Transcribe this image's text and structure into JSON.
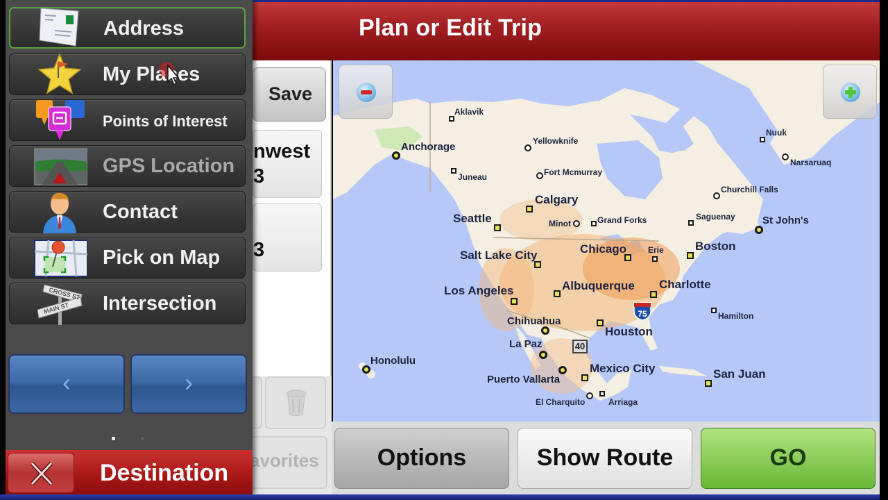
{
  "header": {
    "title": "Plan or Edit Trip"
  },
  "trip_list": {
    "save_label": "Save",
    "stops": [
      {
        "line1": "nwest",
        "line2": "3"
      },
      {
        "line1": "",
        "line2": "3"
      }
    ],
    "favorites_label": "avorites"
  },
  "map": {
    "zoom_out_icon": "minus-icon",
    "zoom_in_icon": "plus-icon",
    "labels": [
      {
        "name": "Aklavik",
        "size": "small"
      },
      {
        "name": "Yellowknife",
        "size": "small"
      },
      {
        "name": "Anchorage",
        "size": "med"
      },
      {
        "name": "Juneau",
        "size": "small"
      },
      {
        "name": "Fort Mcmurray",
        "size": "small"
      },
      {
        "name": "Calgary",
        "size": "big"
      },
      {
        "name": "Seattle",
        "size": "big"
      },
      {
        "name": "Minot",
        "size": "small"
      },
      {
        "name": "Grand Forks",
        "size": "small"
      },
      {
        "name": "Saguenay",
        "size": "small"
      },
      {
        "name": "Churchill Falls",
        "size": "small"
      },
      {
        "name": "Nuuk",
        "size": "small"
      },
      {
        "name": "Narsaruaq",
        "size": "small"
      },
      {
        "name": "St John's",
        "size": "med"
      },
      {
        "name": "Boston",
        "size": "big"
      },
      {
        "name": "Salt Lake City",
        "size": "big"
      },
      {
        "name": "Chicago",
        "size": "big"
      },
      {
        "name": "Erie",
        "size": "small"
      },
      {
        "name": "Los Angeles",
        "size": "big"
      },
      {
        "name": "Albuquerque",
        "size": "big"
      },
      {
        "name": "Charlotte",
        "size": "big"
      },
      {
        "name": "Hamilton",
        "size": "small"
      },
      {
        "name": "Chihuahua",
        "size": "med"
      },
      {
        "name": "Houston",
        "size": "big"
      },
      {
        "name": "La Paz",
        "size": "med"
      },
      {
        "name": "Honolulu",
        "size": "med"
      },
      {
        "name": "Mexico City",
        "size": "big"
      },
      {
        "name": "Puerto Vallarta",
        "size": "med"
      },
      {
        "name": "San Juan",
        "size": "big"
      },
      {
        "name": "El Charquito",
        "size": "small"
      },
      {
        "name": "Arriaga",
        "size": "small"
      }
    ],
    "highway_shields": [
      "75",
      "40"
    ]
  },
  "actions": {
    "options_label": "Options",
    "show_route_label": "Show Route",
    "go_label": "GO"
  },
  "destination_panel": {
    "items": [
      {
        "label": "Address",
        "icon": "envelope-icon",
        "active": true
      },
      {
        "label": "My Places",
        "icon": "star-flag-icon"
      },
      {
        "label": "Points of Interest",
        "icon": "poi-pins-icon"
      },
      {
        "label": "GPS Location",
        "icon": "road-arrow-icon",
        "disabled": true
      },
      {
        "label": "Contact",
        "icon": "person-icon"
      },
      {
        "label": "Pick on Map",
        "icon": "map-pin-icon"
      },
      {
        "label": "Intersection",
        "icon": "street-sign-icon"
      }
    ],
    "prev_glyph": "‹",
    "next_glyph": "›",
    "page": 1,
    "page_count": 2,
    "title": "Destination",
    "close_glyph": "✕",
    "colors": {
      "header_red": "#a21f22",
      "go_green": "#69b736",
      "nav_blue": "#3e6aa9",
      "active_border": "#58a33d"
    }
  }
}
